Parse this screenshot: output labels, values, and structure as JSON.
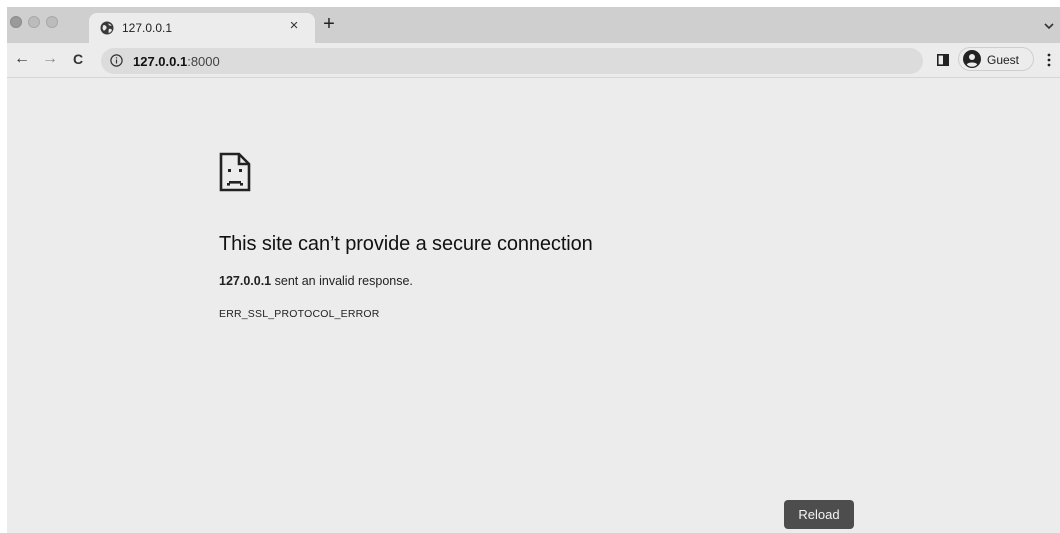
{
  "tab": {
    "title": "127.0.0.1",
    "close_symbol": "×",
    "new_tab_symbol": "+"
  },
  "toolbar": {
    "back_symbol": "←",
    "forward_symbol": "→",
    "reload_symbol": "C",
    "url_host": "127.0.0.1",
    "url_port": ":8000",
    "profile_label": "Guest"
  },
  "error_page": {
    "headline": "This site can’t provide a secure connection",
    "host": "127.0.0.1",
    "description_suffix": " sent an invalid response.",
    "error_code": "ERR_SSL_PROTOCOL_ERROR",
    "reload_label": "Reload"
  },
  "icons": {
    "tab_favicon": "globe-icon",
    "address_info": "info-icon",
    "side_panel": "side-panel-icon",
    "profile": "person-circle-icon",
    "menu": "kebab-menu-icon",
    "error": "sad-document-icon"
  }
}
